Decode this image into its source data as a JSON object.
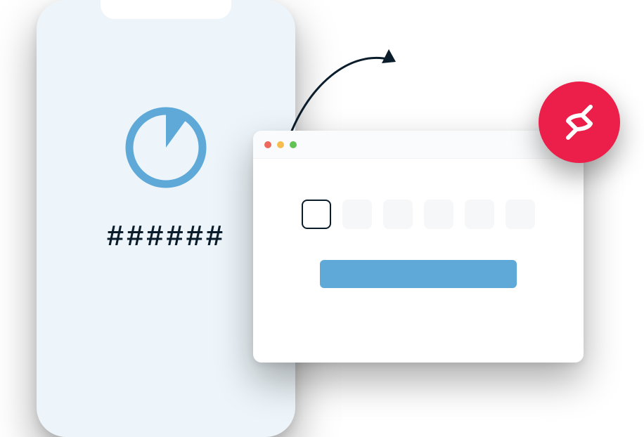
{
  "phone": {
    "otp_placeholder": "######",
    "timer_fraction_remaining": 0.12
  },
  "browser": {
    "pin_input_count": 6,
    "active_input_index": 0
  },
  "badge": {
    "icon_name": "authy-logo"
  },
  "colors": {
    "accent_blue": "#5ea9d8",
    "brand_red": "#ec1f4a",
    "text_dark": "#0b1c2b",
    "phone_bg": "#edf5fa"
  }
}
